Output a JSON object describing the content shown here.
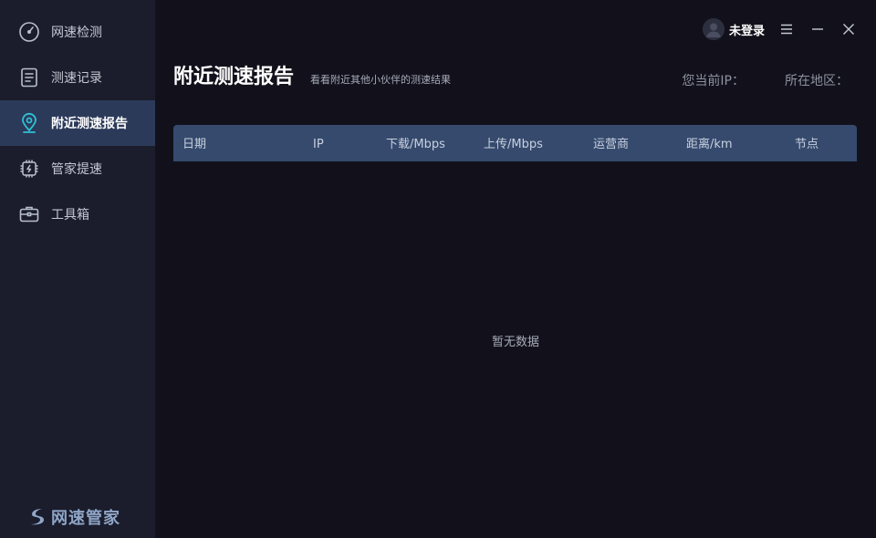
{
  "sidebar": {
    "items": [
      {
        "label": "网速检测",
        "icon": "speedometer-icon"
      },
      {
        "label": "测速记录",
        "icon": "document-icon"
      },
      {
        "label": "附近测速报告",
        "icon": "location-pin-icon"
      },
      {
        "label": "管家提速",
        "icon": "chip-icon"
      },
      {
        "label": "工具箱",
        "icon": "toolbox-icon"
      }
    ],
    "active_index": 2,
    "brand": "网速管家"
  },
  "titlebar": {
    "login": "未登录"
  },
  "page": {
    "title": "附近测速报告",
    "subtitle": "看看附近其他小伙伴的测速结果",
    "ip_label": "您当前IP：",
    "region_label": "所在地区："
  },
  "table": {
    "columns": [
      "日期",
      "IP",
      "下载/Mbps",
      "上传/Mbps",
      "运营商",
      "距离/km",
      "节点"
    ],
    "empty_text": "暂无数据"
  },
  "colors": {
    "sidebar_bg": "#1b1d2c",
    "main_bg": "#12111b",
    "active_bg": "#2c3a5a",
    "accent": "#2fc2d6",
    "table_header_bg": "#354a6d"
  }
}
